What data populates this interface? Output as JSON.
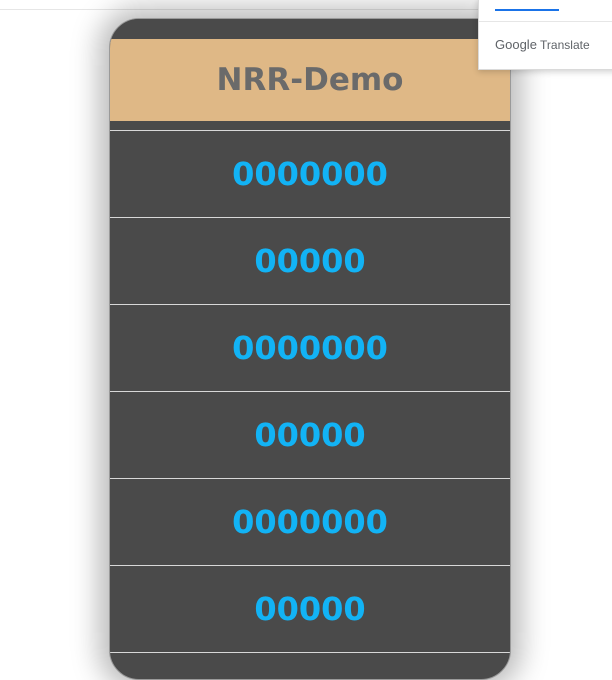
{
  "app": {
    "title": "NRR-Demo"
  },
  "list": {
    "items": [
      {
        "label": "0000000"
      },
      {
        "label": "00000"
      },
      {
        "label": "0000000"
      },
      {
        "label": "00000"
      },
      {
        "label": "0000000"
      },
      {
        "label": "00000"
      }
    ]
  },
  "translate_popup": {
    "brand": "Google",
    "product": "Translate"
  },
  "colors": {
    "header_bg": "#dfb886",
    "title_text": "#6a6a6a",
    "list_bg": "#4a4a4a",
    "item_text": "#12b3f5",
    "divider": "#d8d8d8"
  }
}
